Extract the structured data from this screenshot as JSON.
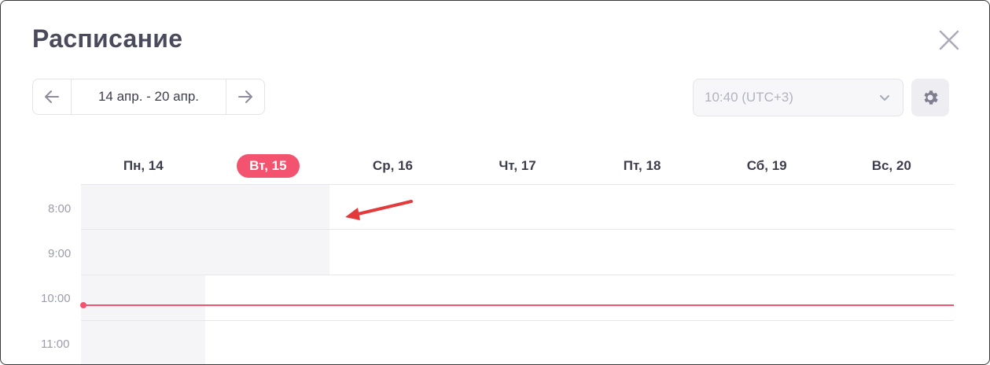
{
  "modal": {
    "title": "Расписание"
  },
  "week_nav": {
    "range": "14 апр. - 20 апр."
  },
  "timezone": {
    "value": "10:40 (UTC+3)"
  },
  "days": [
    "Пн, 14",
    "Вт, 15",
    "Ср, 16",
    "Чт, 17",
    "Пт, 18",
    "Сб, 19",
    "Вс, 20"
  ],
  "today_index": 1,
  "times": [
    "8:00",
    "9:00",
    "10:00",
    "11:00"
  ],
  "colors": {
    "accent": "#f3536e",
    "text": "#3d3d4e",
    "muted": "#9c9cab",
    "annotation": "#e33b3b"
  },
  "icons": {
    "close": "close-icon",
    "prev": "arrow-left-icon",
    "next": "arrow-right-icon",
    "dropdown": "chevron-down-icon",
    "settings": "gear-icon"
  }
}
